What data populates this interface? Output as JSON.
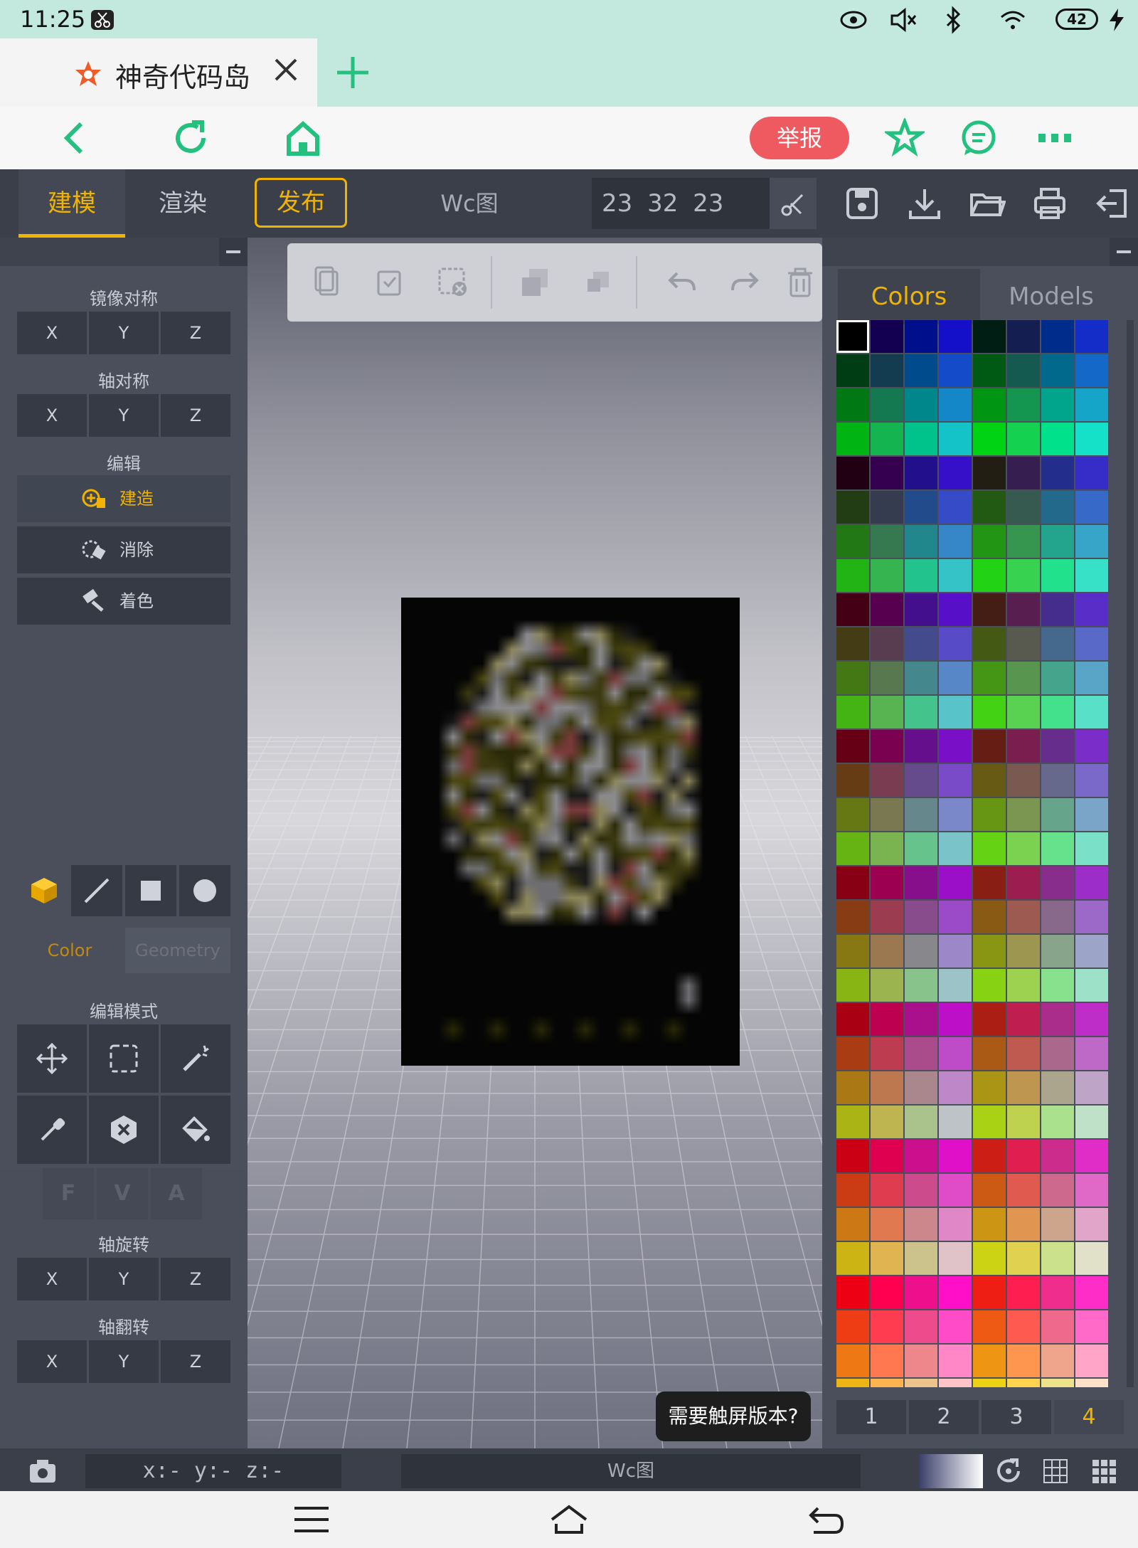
{
  "status": {
    "time": "11:25",
    "battery": "42"
  },
  "tab": {
    "title": "神奇代码岛"
  },
  "nav": {
    "report": "举报"
  },
  "toolbar": {
    "tabs": [
      "建模",
      "渲染",
      "发布"
    ],
    "title": "Wc图",
    "dims": "23 32 23"
  },
  "left": {
    "mirror_title": "镜像对称",
    "axis_sym_title": "轴对称",
    "edit_title": "编辑",
    "build": "建造",
    "erase": "消除",
    "paint": "着色",
    "color_tab": "Color",
    "geometry_tab": "Geometry",
    "edit_mode_title": "编辑模式",
    "fva": [
      "F",
      "V",
      "A"
    ],
    "rotate_title": "轴旋转",
    "flip_title": "轴翻转",
    "axes": [
      "X",
      "Y",
      "Z"
    ]
  },
  "right": {
    "colors_tab": "Colors",
    "models_tab": "Models",
    "pages": [
      "1",
      "2",
      "3",
      "4"
    ],
    "active_page": "4",
    "selected_color": "#000000"
  },
  "tooltip": "需要触屏版本?",
  "bottom": {
    "coords": "x:- y:- z:-",
    "title": "Wc图"
  },
  "colors": {
    "accent": "#f0b400",
    "report": "#ee5a5f",
    "panel": "#4a4f5b"
  },
  "icons": [
    "camera-icon",
    "rotate-icon",
    "grid-icon",
    "grid-dense-icon",
    "save-icon",
    "download-icon",
    "folder-icon",
    "print-icon",
    "exit-icon"
  ]
}
